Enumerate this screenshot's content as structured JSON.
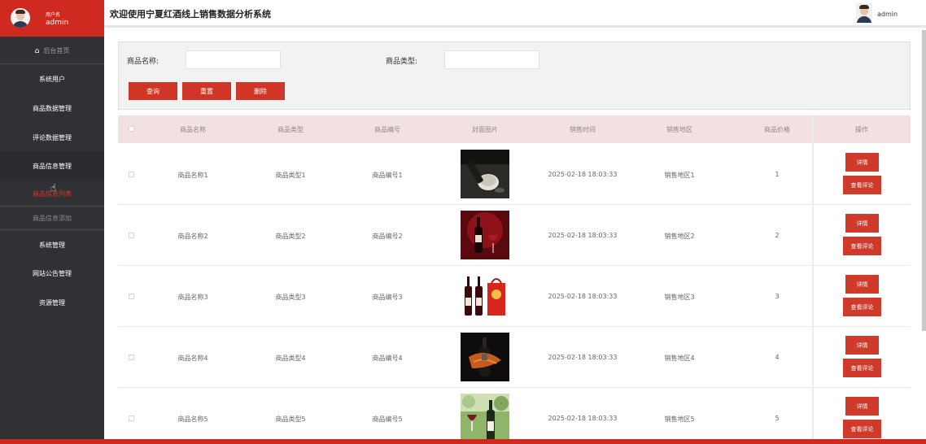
{
  "sidebar": {
    "role": "用户名",
    "username": "admin",
    "home": "后台首页",
    "items": [
      "系统用户",
      "商品数据管理",
      "评论数据管理",
      "商品信息管理"
    ],
    "sub_current": "商品信息列表",
    "sub_add": "商品信息添加",
    "items2": [
      "系统管理",
      "网站公告管理",
      "资源管理"
    ]
  },
  "header": {
    "title": "欢迎使用宁夏红酒线上销售数据分析系统",
    "user": "admin"
  },
  "search": {
    "name_label": "商品名称:",
    "name_value": "",
    "type_label": "商品类型:",
    "type_value": "",
    "query": "查询",
    "reset": "重置",
    "delete": "删除"
  },
  "table": {
    "columns": [
      "商品名称",
      "商品类型",
      "商品编号",
      "封面图片",
      "销售时间",
      "销售地区",
      "商品价格",
      "操作"
    ],
    "rows": [
      {
        "name": "商品名称1",
        "type": "商品类型1",
        "code": "商品编号1",
        "time": "2025-02-18 18:03:33",
        "region": "销售地区1",
        "price": "1",
        "img": "wine-glass-dark-image"
      },
      {
        "name": "商品名称2",
        "type": "商品类型2",
        "code": "商品编号2",
        "time": "2025-02-18 18:03:33",
        "region": "销售地区2",
        "price": "2",
        "img": "wine-bottle-red-image"
      },
      {
        "name": "商品名称3",
        "type": "商品类型3",
        "code": "商品编号3",
        "time": "2025-02-18 18:03:33",
        "region": "销售地区3",
        "price": "3",
        "img": "wine-giftbox-image"
      },
      {
        "name": "商品名称4",
        "type": "商品类型4",
        "code": "商品编号4",
        "time": "2025-02-18 18:03:33",
        "region": "销售地区4",
        "price": "4",
        "img": "wine-ribbon-image"
      },
      {
        "name": "商品名称5",
        "type": "商品类型5",
        "code": "商品编号5",
        "time": "2025-02-18 18:03:33",
        "region": "销售地区5",
        "price": "5",
        "img": "wine-outdoor-image"
      }
    ],
    "detail_label": "详情",
    "review_label": "查看评论"
  },
  "colors": {
    "accent": "#d02a20",
    "sidebar": "#2f3135",
    "table_head": "#f3e1e2"
  }
}
